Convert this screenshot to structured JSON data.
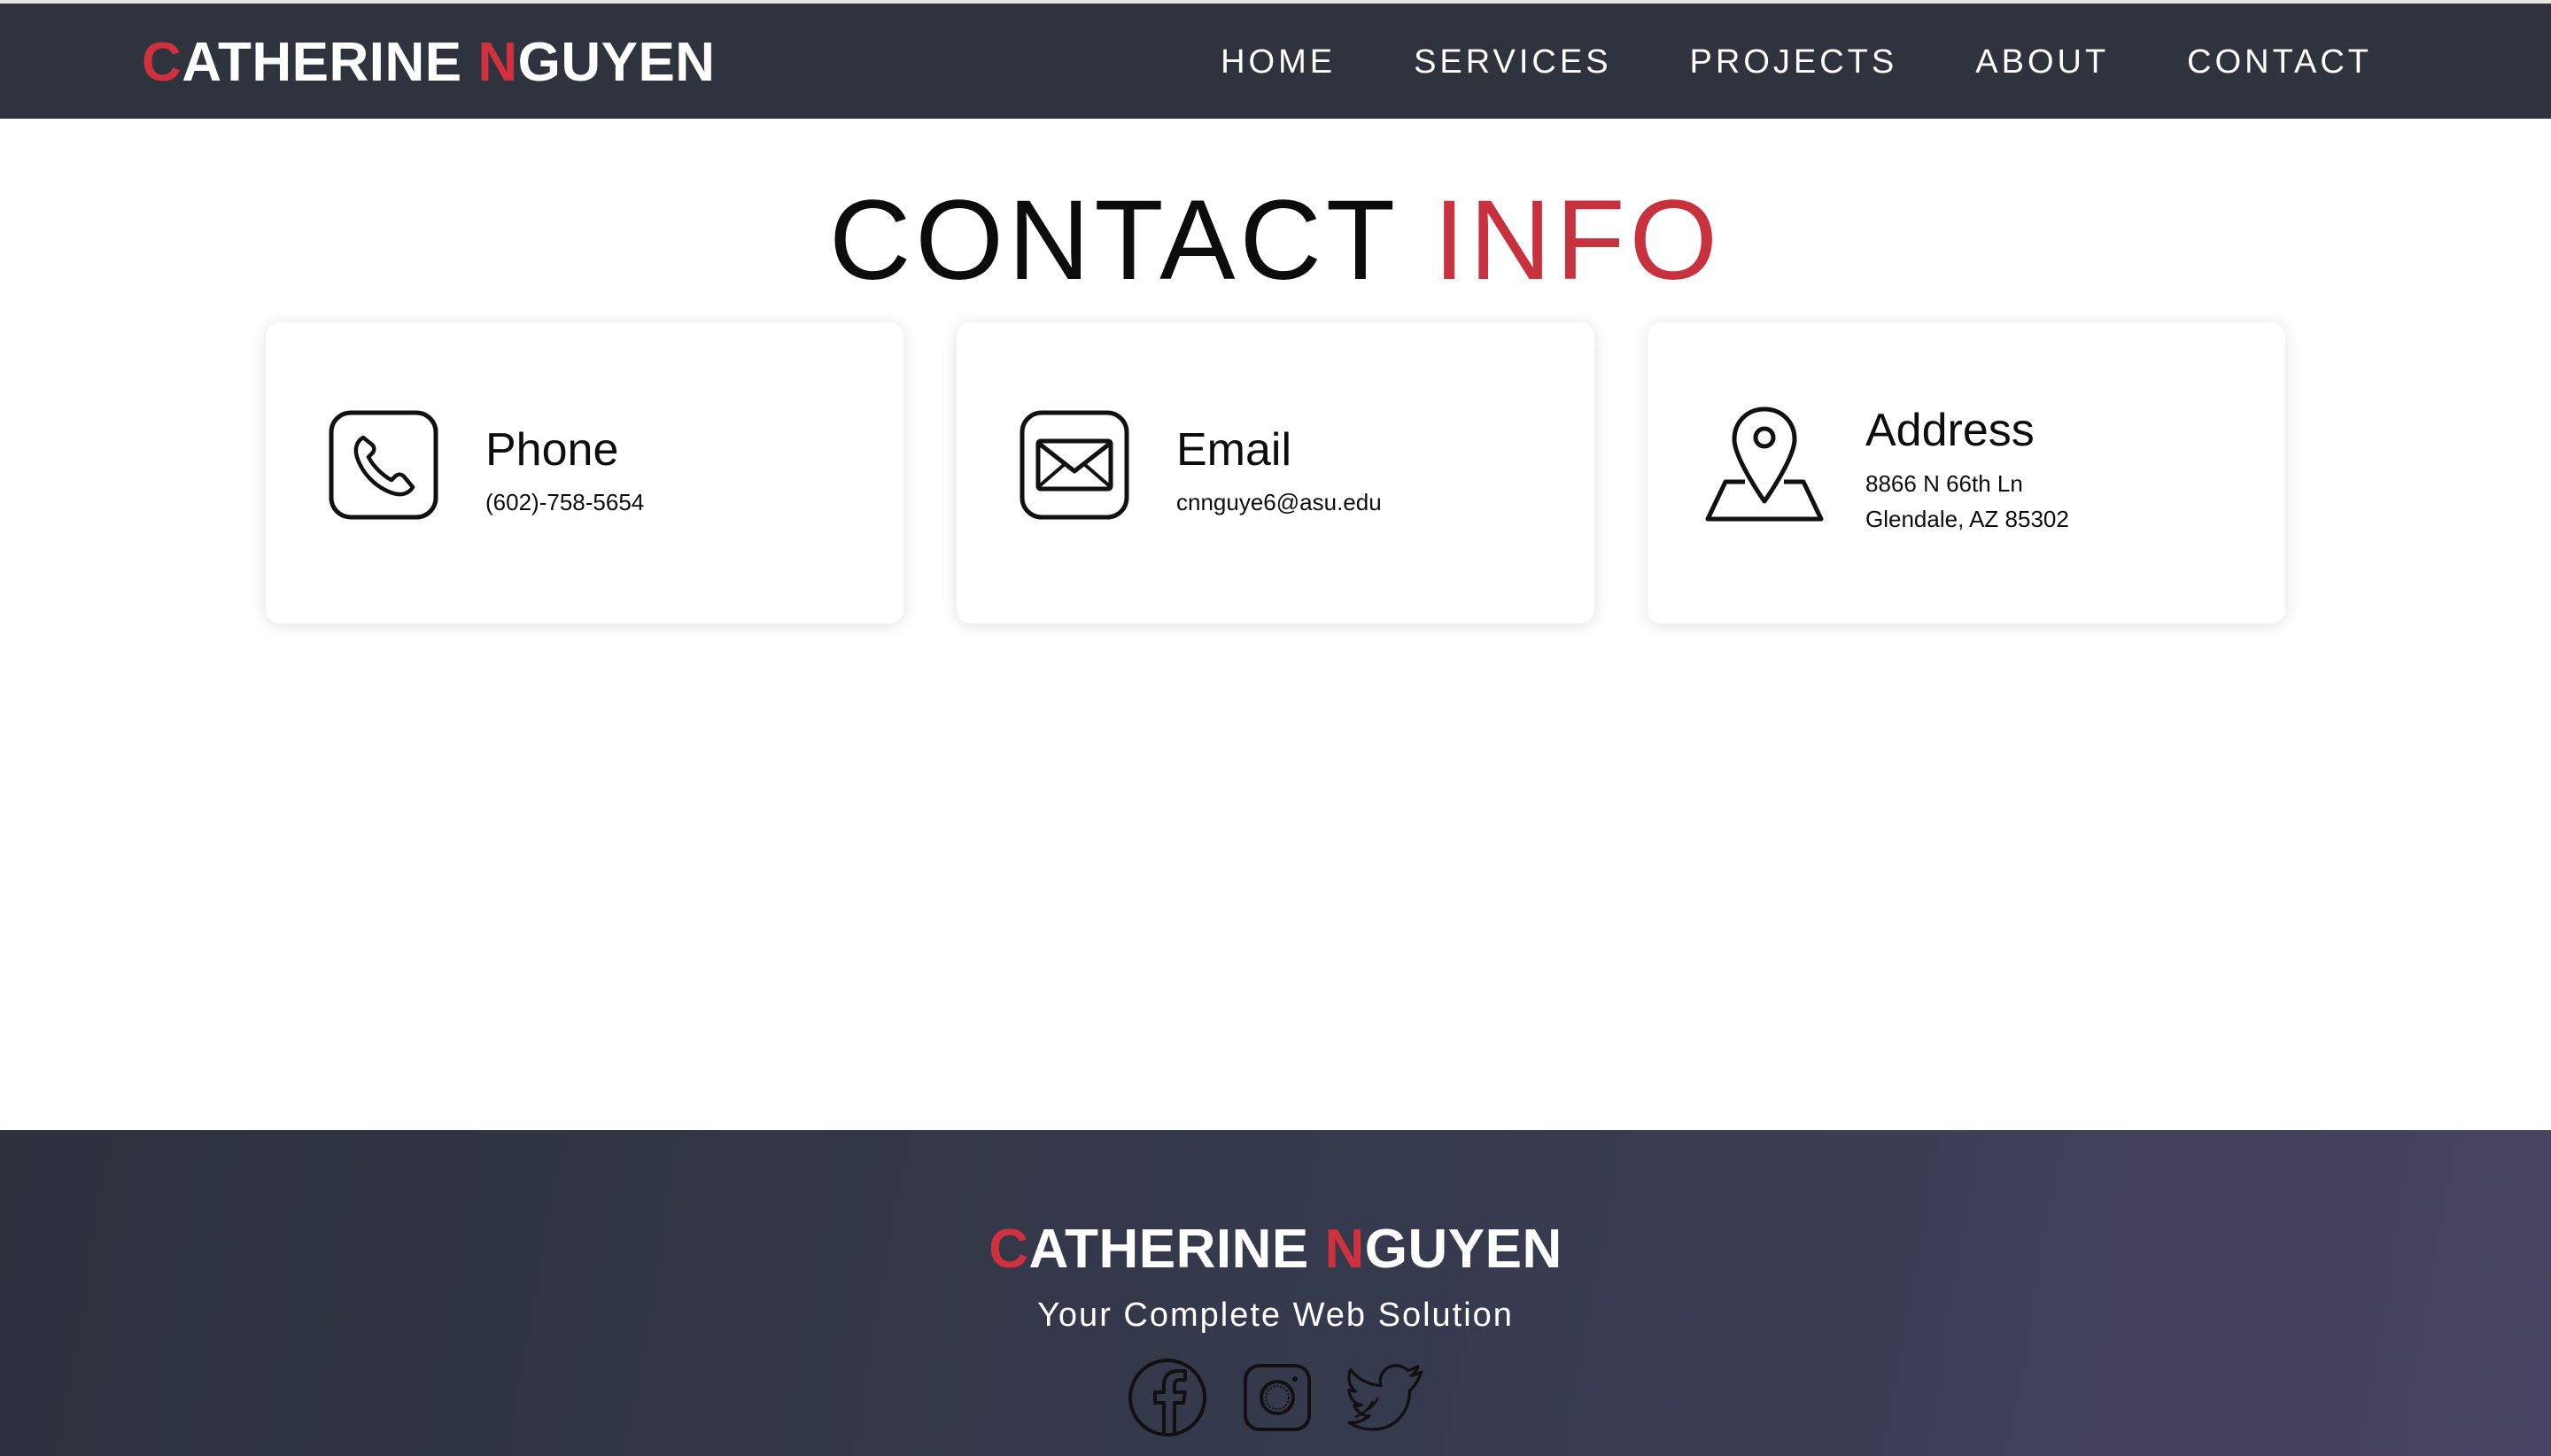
{
  "header": {
    "logo": {
      "first_initial": "C",
      "first_rest": "ATHERINE ",
      "last_initial": "N",
      "last_rest": "GUYEN"
    },
    "nav": [
      "HOME",
      "SERVICES",
      "PROJECTS",
      "ABOUT",
      "CONTACT"
    ]
  },
  "page_title": {
    "part1": "CONTACT ",
    "part2": "INFO"
  },
  "cards": {
    "phone": {
      "title": "Phone",
      "line1": "(602)-758-5654",
      "icon": "phone-icon"
    },
    "email": {
      "title": "Email",
      "line1": "cnnguye6@asu.edu",
      "icon": "envelope-icon"
    },
    "address": {
      "title": "Address",
      "line1": "8866 N 66th Ln",
      "line2": "Glendale, AZ 85302",
      "icon": "map-pin-icon"
    }
  },
  "footer": {
    "logo": {
      "first_initial": "C",
      "first_rest": "ATHERINE ",
      "last_initial": "N",
      "last_rest": "GUYEN"
    },
    "tagline": "Your Complete Web Solution",
    "socials": [
      "facebook-icon",
      "instagram-icon",
      "twitter-icon"
    ]
  },
  "colors": {
    "accent": "#c8313e",
    "navbar": "#2e333d",
    "footer_start": "#2d323d",
    "footer_end": "#464462",
    "text": "#0d0d0d"
  }
}
